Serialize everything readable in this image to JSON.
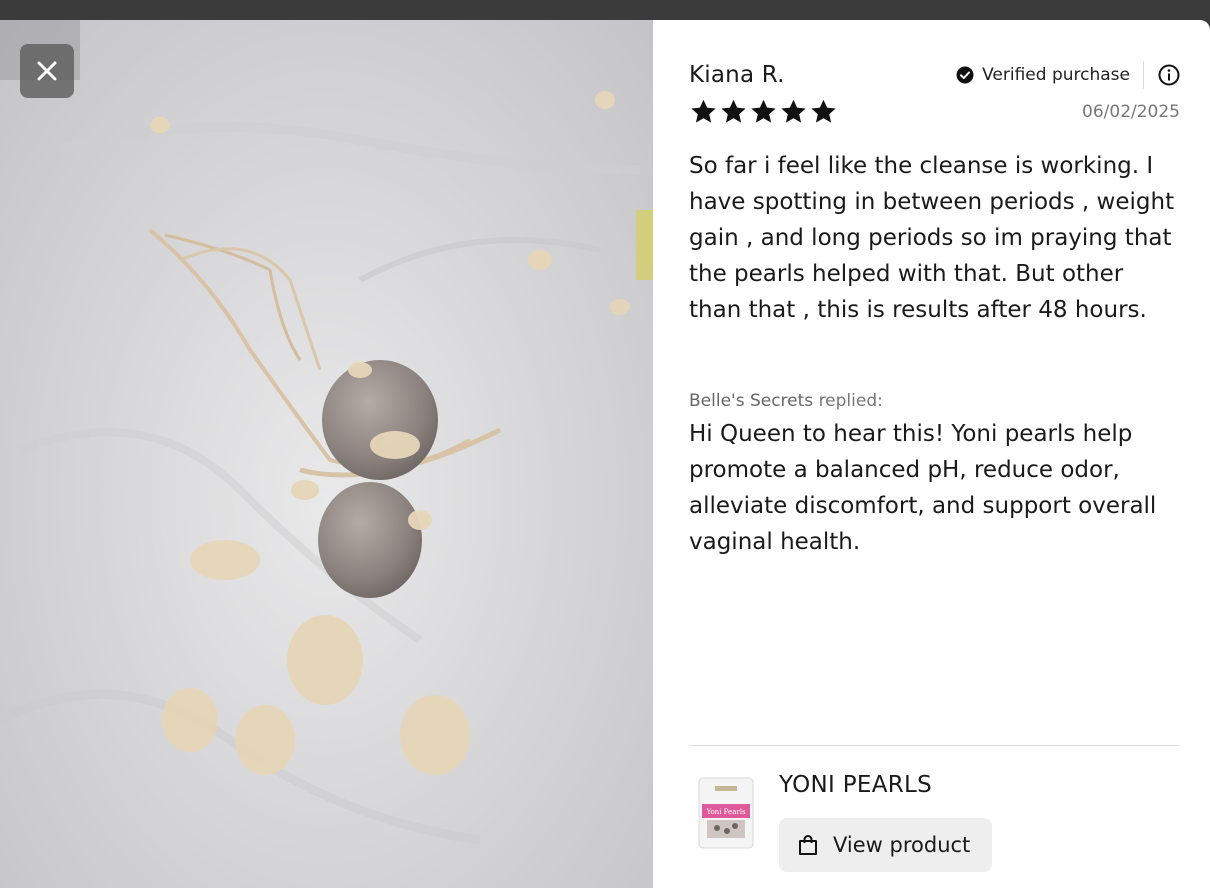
{
  "review": {
    "author": "Kiana R.",
    "verified_label": "Verified purchase",
    "rating": 5,
    "rating_max": 5,
    "date": "06/02/2025",
    "body": "So far i feel like the cleanse is working. I have spotting in between periods , weight gain , and long periods so im praying that the pearls helped with that. But other than that , this is results after 48 hours."
  },
  "reply": {
    "from": "Belle's Secrets",
    "suffix": "replied:",
    "body": "Hi Queen to hear this! Yoni pearls help promote a balanced pH, reduce odor, alleviate discomfort, and support overall vaginal health."
  },
  "product": {
    "name": "YONI PEARLS",
    "button_label": "View product",
    "thumb_title": "Yoni Pearls"
  },
  "icons": {
    "close": "close-icon",
    "verified": "check-circle-icon",
    "info": "info-icon",
    "star": "star-icon",
    "bag": "shopping-bag-icon"
  },
  "colors": {
    "overlay": "#3b3b3b",
    "panel": "#ffffff",
    "star": "#111111",
    "button_bg": "#eeeeee",
    "muted_text": "#777777"
  }
}
